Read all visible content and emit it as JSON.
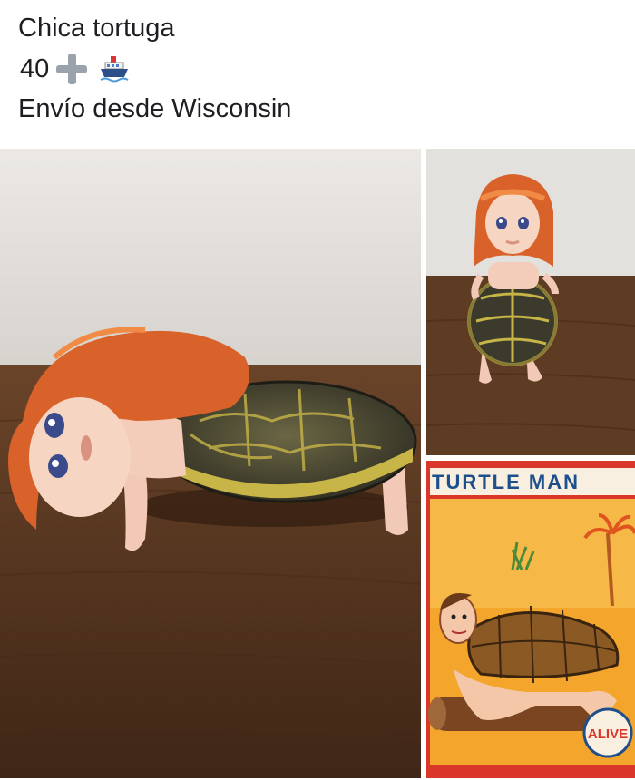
{
  "post": {
    "title": "Chica tortuga",
    "price": "40",
    "price_icons": [
      "heavy-plus-icon",
      "ship-icon"
    ],
    "shipping": "Envío desde Wisconsin"
  },
  "photos": [
    {
      "id": "main",
      "icon": "doll-with-turtle-shell-lying-photo"
    },
    {
      "id": "side-top",
      "icon": "doll-with-turtle-shell-standing-photo"
    },
    {
      "id": "side-bottom",
      "icon": "turtle-man-poster-photo",
      "poster_title": "TURTLE MAN",
      "poster_badge": "ALIVE"
    }
  ],
  "colors": {
    "wall": "#e6e4e1",
    "wood": "#5a3a22",
    "hair": "#d9622a",
    "shell_dark": "#3b3a2c",
    "shell_yellow": "#c8b547",
    "poster_bg": "#f4a52b",
    "poster_red": "#d9372a"
  }
}
